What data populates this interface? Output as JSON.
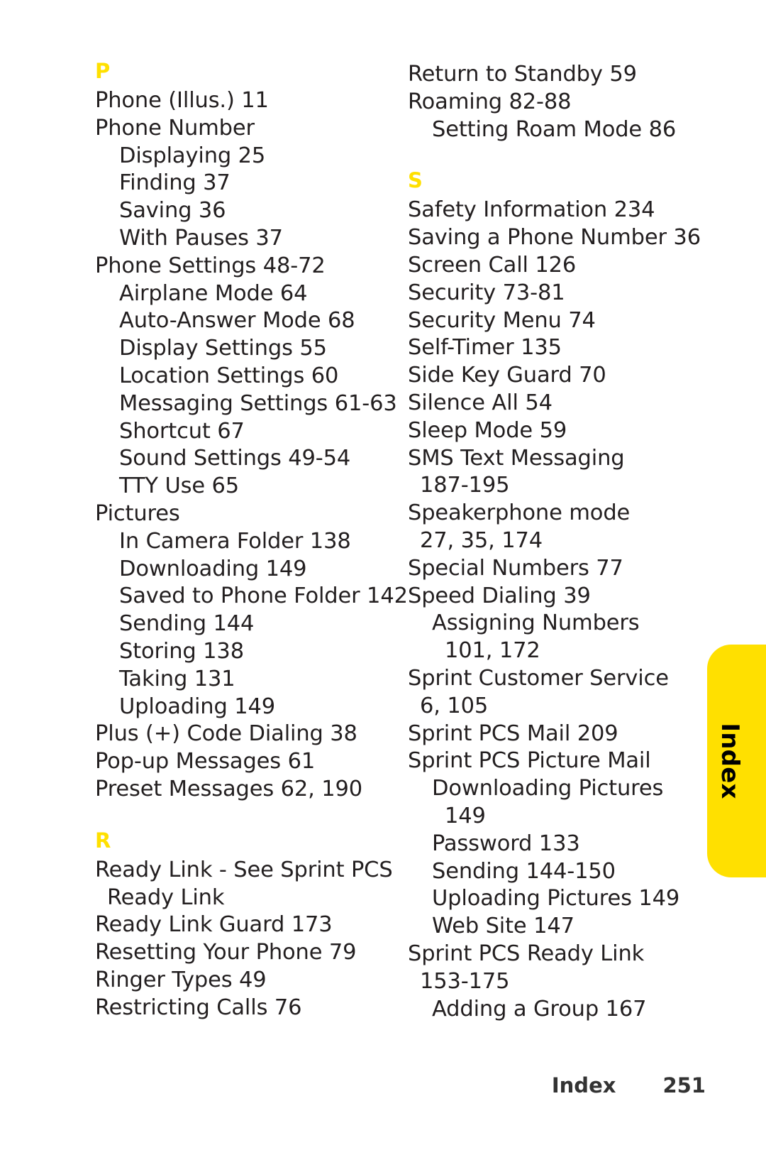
{
  "document": {
    "page_number": "251",
    "footer_label": "Index",
    "tab_label": "Index",
    "accent_color": "#ffe000",
    "text_color": "#231f20"
  },
  "columns": {
    "left": [
      {
        "type": "heading",
        "text": "P",
        "spaced": false
      },
      {
        "type": "entry",
        "level": 0,
        "text": "Phone (Illus.) 11"
      },
      {
        "type": "entry",
        "level": 0,
        "text": "Phone Number"
      },
      {
        "type": "entry",
        "level": 1,
        "text": "Displaying 25"
      },
      {
        "type": "entry",
        "level": 1,
        "text": "Finding 37"
      },
      {
        "type": "entry",
        "level": 1,
        "text": "Saving 36"
      },
      {
        "type": "entry",
        "level": 1,
        "text": "With Pauses 37"
      },
      {
        "type": "entry",
        "level": 0,
        "text": "Phone Settings 48-72"
      },
      {
        "type": "entry",
        "level": 1,
        "text": "Airplane Mode 64"
      },
      {
        "type": "entry",
        "level": 1,
        "text": "Auto-Answer Mode 68"
      },
      {
        "type": "entry",
        "level": 1,
        "text": "Display Settings 55"
      },
      {
        "type": "entry",
        "level": 1,
        "text": "Location Settings 60"
      },
      {
        "type": "entry",
        "level": 1,
        "text": "Messaging Settings 61-63"
      },
      {
        "type": "entry",
        "level": 1,
        "text": "Shortcut 67"
      },
      {
        "type": "entry",
        "level": 1,
        "text": "Sound Settings 49-54"
      },
      {
        "type": "entry",
        "level": 1,
        "text": "TTY Use 65"
      },
      {
        "type": "entry",
        "level": 0,
        "text": "Pictures"
      },
      {
        "type": "entry",
        "level": 1,
        "text": "In Camera Folder 138"
      },
      {
        "type": "entry",
        "level": 1,
        "text": "Downloading 149"
      },
      {
        "type": "entry",
        "level": 1,
        "text": "Saved to Phone Folder 142"
      },
      {
        "type": "entry",
        "level": 1,
        "text": "Sending 144"
      },
      {
        "type": "entry",
        "level": 1,
        "text": "Storing 138"
      },
      {
        "type": "entry",
        "level": 1,
        "text": "Taking 131"
      },
      {
        "type": "entry",
        "level": 1,
        "text": "Uploading 149"
      },
      {
        "type": "entry",
        "level": 0,
        "text": "Plus (+) Code Dialing 38"
      },
      {
        "type": "entry",
        "level": 0,
        "text": "Pop-up Messages 61"
      },
      {
        "type": "entry",
        "level": 0,
        "text": "Preset Messages 62, 190"
      },
      {
        "type": "heading",
        "text": "R",
        "spaced": true
      },
      {
        "type": "entry",
        "level": 0,
        "text": "Ready Link - See Sprint PCS"
      },
      {
        "type": "entry",
        "level": "cont1",
        "text": "Ready Link"
      },
      {
        "type": "entry",
        "level": 0,
        "text": "Ready Link Guard 173"
      },
      {
        "type": "entry",
        "level": 0,
        "text": "Resetting Your Phone 79"
      },
      {
        "type": "entry",
        "level": 0,
        "text": "Ringer Types 49"
      },
      {
        "type": "entry",
        "level": 0,
        "text": "Restricting Calls 76"
      }
    ],
    "right": [
      {
        "type": "entry",
        "level": 0,
        "text": "Return to Standby 59"
      },
      {
        "type": "entry",
        "level": 0,
        "text": "Roaming 82-88"
      },
      {
        "type": "entry",
        "level": 1,
        "text": "Setting Roam Mode 86"
      },
      {
        "type": "heading",
        "text": "S",
        "spaced": true
      },
      {
        "type": "entry",
        "level": 0,
        "text": "Safety Information 234"
      },
      {
        "type": "entry",
        "level": 0,
        "text": "Saving a Phone Number 36"
      },
      {
        "type": "entry",
        "level": 0,
        "text": "Screen Call 126"
      },
      {
        "type": "entry",
        "level": 0,
        "text": "Security 73-81"
      },
      {
        "type": "entry",
        "level": 0,
        "text": "Security Menu 74"
      },
      {
        "type": "entry",
        "level": 0,
        "text": "Self-Timer 135"
      },
      {
        "type": "entry",
        "level": 0,
        "text": "Side Key Guard 70"
      },
      {
        "type": "entry",
        "level": 0,
        "text": "Silence All 54"
      },
      {
        "type": "entry",
        "level": 0,
        "text": "Sleep Mode 59"
      },
      {
        "type": "entry",
        "level": 0,
        "text": "SMS Text Messaging"
      },
      {
        "type": "entry",
        "level": "cont1",
        "text": "187-195"
      },
      {
        "type": "entry",
        "level": 0,
        "text": "Speakerphone mode"
      },
      {
        "type": "entry",
        "level": "cont1",
        "text": "27, 35, 174"
      },
      {
        "type": "entry",
        "level": 0,
        "text": "Special Numbers 77"
      },
      {
        "type": "entry",
        "level": 0,
        "text": "Speed Dialing 39"
      },
      {
        "type": "entry",
        "level": 1,
        "text": "Assigning Numbers"
      },
      {
        "type": "entry",
        "level": 2,
        "text": "101, 172"
      },
      {
        "type": "entry",
        "level": 0,
        "text": "Sprint Customer Service"
      },
      {
        "type": "entry",
        "level": "cont1",
        "text": "6, 105"
      },
      {
        "type": "entry",
        "level": 0,
        "text": "Sprint PCS Mail 209"
      },
      {
        "type": "entry",
        "level": 0,
        "text": "Sprint PCS Picture Mail"
      },
      {
        "type": "entry",
        "level": 1,
        "text": "Downloading Pictures"
      },
      {
        "type": "entry",
        "level": 2,
        "text": "149"
      },
      {
        "type": "entry",
        "level": 1,
        "text": "Password 133"
      },
      {
        "type": "entry",
        "level": 1,
        "text": "Sending 144-150"
      },
      {
        "type": "entry",
        "level": 1,
        "text": "Uploading Pictures 149"
      },
      {
        "type": "entry",
        "level": 1,
        "text": "Web Site 147"
      },
      {
        "type": "entry",
        "level": 0,
        "text": "Sprint PCS Ready Link"
      },
      {
        "type": "entry",
        "level": "cont1",
        "text": "153-175"
      },
      {
        "type": "entry",
        "level": 1,
        "text": "Adding a Group 167"
      }
    ]
  }
}
